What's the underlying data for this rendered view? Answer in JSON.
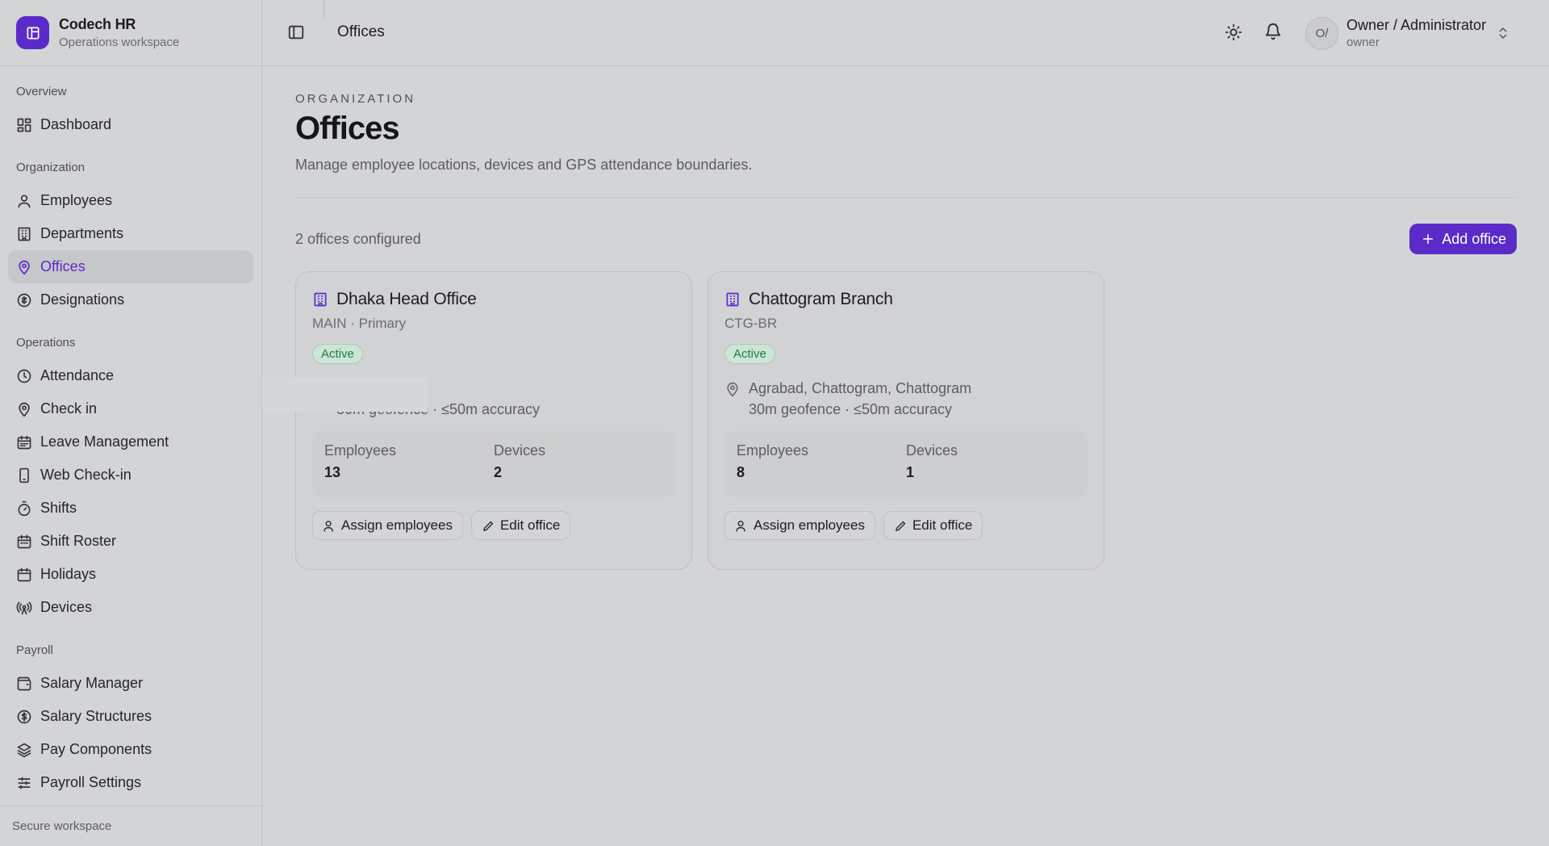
{
  "brand": {
    "title": "Codech HR",
    "subtitle": "Operations workspace"
  },
  "sidebar": {
    "sections": [
      {
        "label": "Overview",
        "items": [
          {
            "label": "Dashboard",
            "icon": "dashboard-icon"
          }
        ]
      },
      {
        "label": "Organization",
        "items": [
          {
            "label": "Employees",
            "icon": "user-icon"
          },
          {
            "label": "Departments",
            "icon": "building-icon"
          },
          {
            "label": "Offices",
            "icon": "map-pin-icon",
            "active": true
          },
          {
            "label": "Designations",
            "icon": "badge-icon"
          }
        ]
      },
      {
        "label": "Operations",
        "items": [
          {
            "label": "Attendance",
            "icon": "clock-icon"
          },
          {
            "label": "Check in",
            "icon": "map-pin-icon"
          },
          {
            "label": "Leave Management",
            "icon": "calendar-icon"
          },
          {
            "label": "Web Check-in",
            "icon": "phone-icon"
          },
          {
            "label": "Shifts",
            "icon": "timer-icon"
          },
          {
            "label": "Shift Roster",
            "icon": "calendar-icon"
          },
          {
            "label": "Holidays",
            "icon": "calendar-icon"
          },
          {
            "label": "Devices",
            "icon": "radio-icon"
          }
        ]
      },
      {
        "label": "Payroll",
        "items": [
          {
            "label": "Salary Manager",
            "icon": "wallet-icon"
          },
          {
            "label": "Salary Structures",
            "icon": "dollar-circle-icon"
          },
          {
            "label": "Pay Components",
            "icon": "layers-icon"
          },
          {
            "label": "Payroll Settings",
            "icon": "sliders-icon"
          }
        ]
      }
    ],
    "footer": "Secure workspace"
  },
  "header": {
    "title": "Offices",
    "user": {
      "initials": "O/",
      "name": "Owner / Administrator",
      "role": "owner"
    }
  },
  "page": {
    "eyebrow": "ORGANIZATION",
    "title": "Offices",
    "description": "Manage employee locations, devices and GPS attendance boundaries.",
    "count": "2 offices configured",
    "add_button": "Add office"
  },
  "offices": [
    {
      "name": "Dhaka Head Office",
      "code": "MAIN · Primary",
      "status": "Active",
      "address": "",
      "geofence": "30m geofence · ≤50m accuracy",
      "employees_label": "Employees",
      "employees": "13",
      "devices_label": "Devices",
      "devices": "2",
      "assign_label": "Assign employees",
      "edit_label": "Edit office"
    },
    {
      "name": "Chattogram Branch",
      "code": "CTG-BR",
      "status": "Active",
      "address": "Agrabad, Chattogram, Chattogram",
      "geofence": "30m geofence · ≤50m accuracy",
      "employees_label": "Employees",
      "employees": "8",
      "devices_label": "Devices",
      "devices": "1",
      "assign_label": "Assign employees",
      "edit_label": "Edit office"
    }
  ],
  "colors": {
    "accent": "#5b2bc9",
    "success": "#13824d",
    "background": "#d3d4d6"
  }
}
